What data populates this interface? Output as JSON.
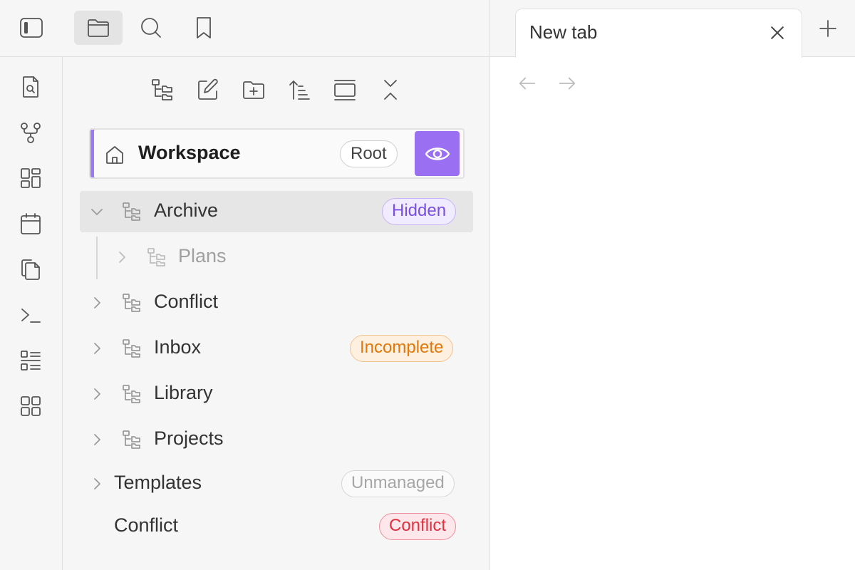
{
  "topbar": {
    "buttons": [
      {
        "icon": "sidebar-toggle-icon",
        "active": false
      },
      {
        "icon": "folder-icon",
        "active": true
      },
      {
        "icon": "search-icon",
        "active": false
      },
      {
        "icon": "bookmark-icon",
        "active": false
      }
    ]
  },
  "ribbon": {
    "icons": [
      "file-search-icon",
      "graph-icon",
      "dashboard-icon",
      "calendar-icon",
      "copy-icon",
      "terminal-icon",
      "list-icon",
      "grid-icon"
    ]
  },
  "nav_actions": {
    "icons": [
      "folder-tree-icon",
      "edit-icon",
      "new-folder-icon",
      "sort-icon",
      "collapse-view-icon",
      "collapse-all-icon"
    ]
  },
  "workspace": {
    "title": "Workspace",
    "badge": "Root",
    "accent": "#9b6ff2"
  },
  "tree": {
    "items": [
      {
        "label": "Archive",
        "badge": "Hidden",
        "expanded": true,
        "selected": true
      },
      {
        "label": "Plans",
        "badge": "",
        "muted": true
      },
      {
        "label": "Conflict",
        "badge": ""
      },
      {
        "label": "Inbox",
        "badge": "Incomplete"
      },
      {
        "label": "Library",
        "badge": ""
      },
      {
        "label": "Projects",
        "badge": ""
      },
      {
        "label": "Templates",
        "badge": "Unmanaged"
      },
      {
        "label": "Conflict",
        "badge": "Conflict"
      }
    ]
  },
  "tabs": {
    "active_title": "New tab"
  },
  "colors": {
    "hidden": "#7a4fe0",
    "incomplete": "#e0780c",
    "unmanaged": "#a6a6a6",
    "conflict": "#e0303f"
  }
}
